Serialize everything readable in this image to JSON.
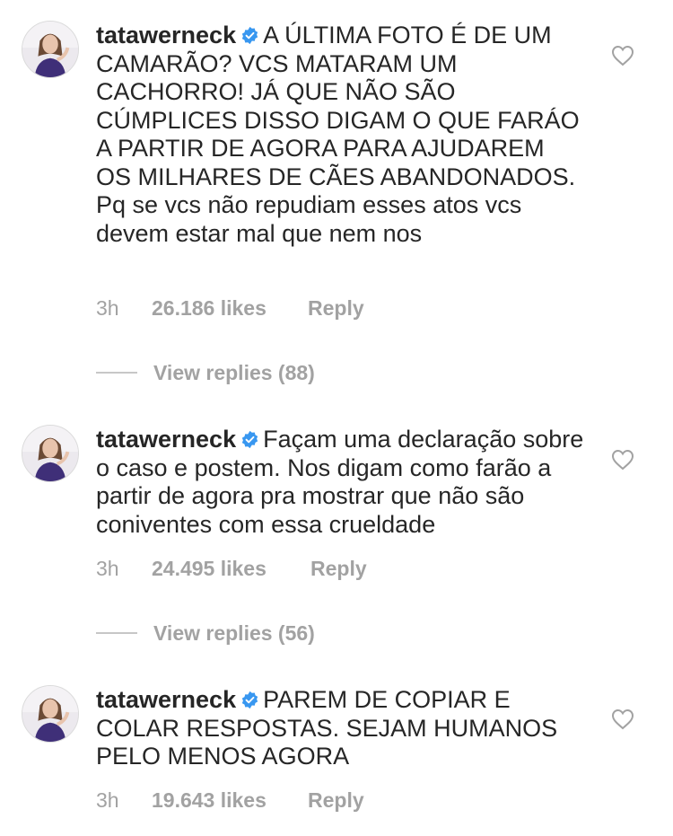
{
  "comments": [
    {
      "username": "tatawerneck",
      "verified_icon": "verified-badge-icon",
      "text": "A ÚLTIMA FOTO É DE UM CAMARÃO? VCS MATARAM UM CACHORRO! JÁ QUE NÃO SÃO CÚMPLICES DISSO DIGAM O QUE FARÁO A PARTIR DE AGORA PARA AJUDAREM OS MILHARES DE CÃES ABANDONADOS. Pq se vcs não repudiam esses atos vcs devem estar mal que nem nos",
      "time": "3h",
      "likes": "26.186 likes",
      "reply_label": "Reply",
      "view_replies": "View replies (88)"
    },
    {
      "username": "tatawerneck",
      "verified_icon": "verified-badge-icon",
      "text": "Façam uma declaração sobre o caso e postem. Nos digam como farão a partir de agora pra mostrar que não são coniventes com essa crueldade",
      "time": "3h",
      "likes": "24.495 likes",
      "reply_label": "Reply",
      "view_replies": "View replies (56)"
    },
    {
      "username": "tatawerneck",
      "verified_icon": "verified-badge-icon",
      "text": "PAREM DE COPIAR E COLAR RESPOSTAS. SEJAM HUMANOS PELO MENOS AGORA",
      "time": "3h",
      "likes": "19.643 likes",
      "reply_label": "Reply"
    }
  ],
  "colors": {
    "text": "#262626",
    "meta": "#a2a2a2",
    "verified": "#3897f0",
    "divider": "#c7c7c7"
  }
}
